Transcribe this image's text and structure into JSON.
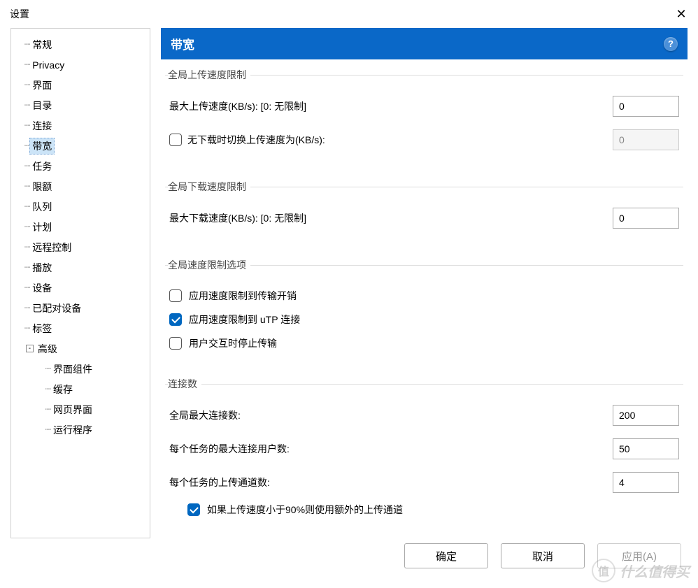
{
  "window": {
    "title": "设置",
    "close_glyph": "✕"
  },
  "sidebar": {
    "items": [
      {
        "label": "常规",
        "depth": 1
      },
      {
        "label": "Privacy",
        "depth": 1
      },
      {
        "label": "界面",
        "depth": 1
      },
      {
        "label": "目录",
        "depth": 1
      },
      {
        "label": "连接",
        "depth": 1
      },
      {
        "label": "带宽",
        "depth": 1,
        "selected": true
      },
      {
        "label": "任务",
        "depth": 1
      },
      {
        "label": "限额",
        "depth": 1
      },
      {
        "label": "队列",
        "depth": 1
      },
      {
        "label": "计划",
        "depth": 1
      },
      {
        "label": "远程控制",
        "depth": 1
      },
      {
        "label": "播放",
        "depth": 1
      },
      {
        "label": "设备",
        "depth": 1
      },
      {
        "label": "已配对设备",
        "depth": 1
      },
      {
        "label": "标签",
        "depth": 1
      },
      {
        "label": "高级",
        "depth": 1,
        "expander": "-"
      },
      {
        "label": "界面组件",
        "depth": 2
      },
      {
        "label": "缓存",
        "depth": 2
      },
      {
        "label": "网页界面",
        "depth": 2
      },
      {
        "label": "运行程序",
        "depth": 2
      }
    ]
  },
  "panel": {
    "title": "带宽",
    "help_glyph": "?",
    "upload_group": {
      "legend": "全局上传速度限制",
      "max_label": "最大上传速度(KB/s): [0: 无限制]",
      "max_value": "0",
      "alt_checked": false,
      "alt_label": "无下载时切换上传速度为(KB/s):",
      "alt_value": "0"
    },
    "download_group": {
      "legend": "全局下载速度限制",
      "max_label": "最大下载速度(KB/s): [0: 无限制]",
      "max_value": "0"
    },
    "options_group": {
      "legend": "全局速度限制选项",
      "opt1_checked": false,
      "opt1_label": "应用速度限制到传输开销",
      "opt2_checked": true,
      "opt2_label": "应用速度限制到 uTP 连接",
      "opt3_checked": false,
      "opt3_label": "用户交互时停止传输"
    },
    "conn_group": {
      "legend": "连接数",
      "global_label": "全局最大连接数:",
      "global_value": "200",
      "pertask_label": "每个任务的最大连接用户数:",
      "pertask_value": "50",
      "slots_label": "每个任务的上传通道数:",
      "slots_value": "4",
      "extra_checked": true,
      "extra_label": "如果上传速度小于90%则使用额外的上传通道"
    }
  },
  "buttons": {
    "ok": "确定",
    "cancel": "取消",
    "apply": "应用(A)"
  },
  "watermark": {
    "badge": "值",
    "text": "什么值得买"
  }
}
